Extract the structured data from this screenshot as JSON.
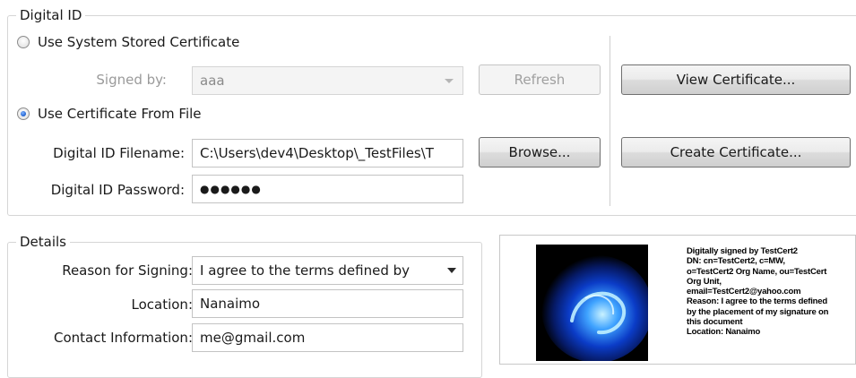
{
  "digital_id": {
    "legend": "Digital ID",
    "system_cert_label": "Use System Stored Certificate",
    "signed_by_label": "Signed by:",
    "signed_by_value": "aaa",
    "refresh_label": "Refresh",
    "view_cert_label": "View Certificate...",
    "file_cert_label": "Use Certificate From File",
    "filename_label": "Digital ID Filename:",
    "filename_value": "C:\\Users\\dev4\\Desktop\\_TestFiles\\T",
    "browse_label": "Browse...",
    "create_cert_label": "Create Certificate...",
    "password_label": "Digital ID Password:",
    "password_value": "●●●●●●"
  },
  "details": {
    "legend": "Details",
    "reason_label": "Reason for Signing:",
    "reason_value": "I agree to the terms defined by",
    "location_label": "Location:",
    "location_value": "Nanaimo",
    "contact_label": "Contact Information:",
    "contact_value": "me@gmail.com"
  },
  "signature_preview": {
    "lines": [
      "Digitally signed by TestCert2",
      "DN: cn=TestCert2, c=MW,",
      "o=TestCert2 Org Name, ou=TestCert",
      "Org Unit,",
      "email=TestCert2@yahoo.com",
      "Reason: I agree to the terms defined",
      "by the placement of my signature on",
      "this document",
      "Location: Nanaimo"
    ]
  }
}
